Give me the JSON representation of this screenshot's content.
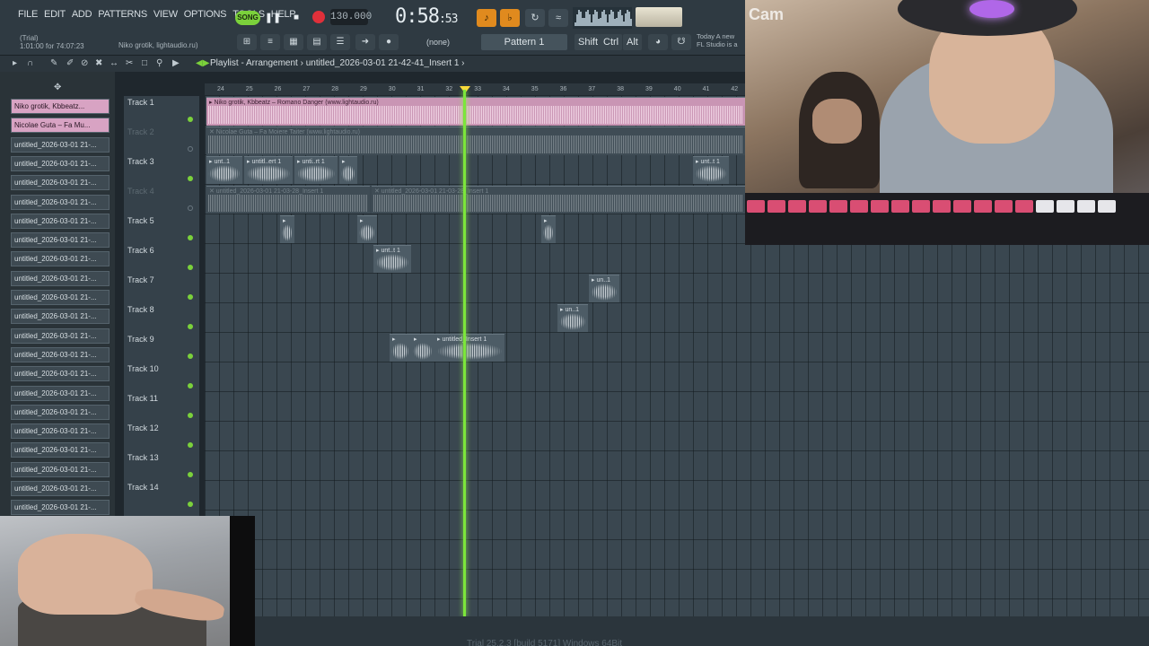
{
  "menu": [
    "FILE",
    "EDIT",
    "ADD",
    "PATTERNS",
    "VIEW",
    "OPTIONS",
    "TOOLS",
    "HELP"
  ],
  "transport": {
    "mode_label": "SONG",
    "tempo": "130.000",
    "time_main": "0:58",
    "time_sub": ":53"
  },
  "hint": {
    "trial": "(Trial)",
    "time_info": "1:01:00 for 74:07:23",
    "song": "Niko grotik, lightaudio.ru)"
  },
  "pattern": {
    "none_label": "(none)",
    "selected": "Pattern 1"
  },
  "modifiers": [
    "Shift",
    "Ctrl",
    "Alt"
  ],
  "news": "Today  A new FL Studio is a",
  "playlist": {
    "title": "Playlist - Arrangement",
    "breadcrumb": "untitled_2026-03-01 21-42-41_Insert 1",
    "ruler": [
      "24",
      "25",
      "26",
      "27",
      "28",
      "29",
      "30",
      "31",
      "32",
      "33",
      "34",
      "35",
      "36",
      "37",
      "38",
      "39",
      "40",
      "41",
      "42"
    ]
  },
  "browser_items": [
    "Niko grotik, Kbbeatz...",
    "Nicolae Guta – Fa Mu...",
    "untitled_2026-03-01 21-...",
    "untitled_2026-03-01 21-...",
    "untitled_2026-03-01 21-...",
    "untitled_2026-03-01 21-...",
    "untitled_2026-03-01 21-...",
    "untitled_2026-03-01 21-...",
    "untitled_2026-03-01 21-...",
    "untitled_2026-03-01 21-...",
    "untitled_2026-03-01 21-...",
    "untitled_2026-03-01 21-...",
    "untitled_2026-03-01 21-...",
    "untitled_2026-03-01 21-...",
    "untitled_2026-03-01 21-...",
    "untitled_2026-03-01 21-...",
    "untitled_2026-03-01 21-...",
    "untitled_2026-03-01 21-...",
    "untitled_2026-03-01 21-...",
    "untitled_2026-03-01 21-...",
    "untitled_2026-03-01 21-...",
    "untitled_2026-03-01 21-..."
  ],
  "tracks": [
    {
      "name": "Track 1",
      "enabled": true
    },
    {
      "name": "Track 2",
      "enabled": false
    },
    {
      "name": "Track 3",
      "enabled": true
    },
    {
      "name": "Track 4",
      "enabled": false
    },
    {
      "name": "Track 5",
      "enabled": true
    },
    {
      "name": "Track 6",
      "enabled": true
    },
    {
      "name": "Track 7",
      "enabled": true
    },
    {
      "name": "Track 8",
      "enabled": true
    },
    {
      "name": "Track 9",
      "enabled": true
    },
    {
      "name": "Track 10",
      "enabled": true
    },
    {
      "name": "Track 11",
      "enabled": true
    },
    {
      "name": "Track 12",
      "enabled": true
    },
    {
      "name": "Track 13",
      "enabled": true
    },
    {
      "name": "Track 14",
      "enabled": true
    }
  ],
  "clips": {
    "t1": "▸ Niko grotik, Kbbeatz – Romano Danger (www.lightaudio.ru)",
    "t2": "✕ Nicolae Guta – Fa Moiere Taiter (www.lightaudio.ru)",
    "t3a": "▸ unt..1",
    "t3b": "▸ untitl..ert 1",
    "t3c": "▸ unti..rt 1",
    "t3d": "▸",
    "t3e": "▸ unt..t 1",
    "t4a": "✕ untitled_2026-03-01 21-03-28_Insert 1",
    "t4b": "✕ untitled_2026-03-01 21-03-28_Insert 1",
    "t5": "▸",
    "t6": "▸ unt..t 1",
    "t7": "▸ un..1",
    "t8": "▸ un..1",
    "t9a": "▸",
    "t9b": "▸",
    "t9c": "▸ untitled_Insert 1"
  },
  "webcam_label": "Cam",
  "footer": "Trial  25.2.3 [build 5171]  Windows  64Bit",
  "colors": {
    "accent": "#7bd13b",
    "playhead": "#7ce63b",
    "song_clip": "#c995b4",
    "record": "#e0303a"
  }
}
